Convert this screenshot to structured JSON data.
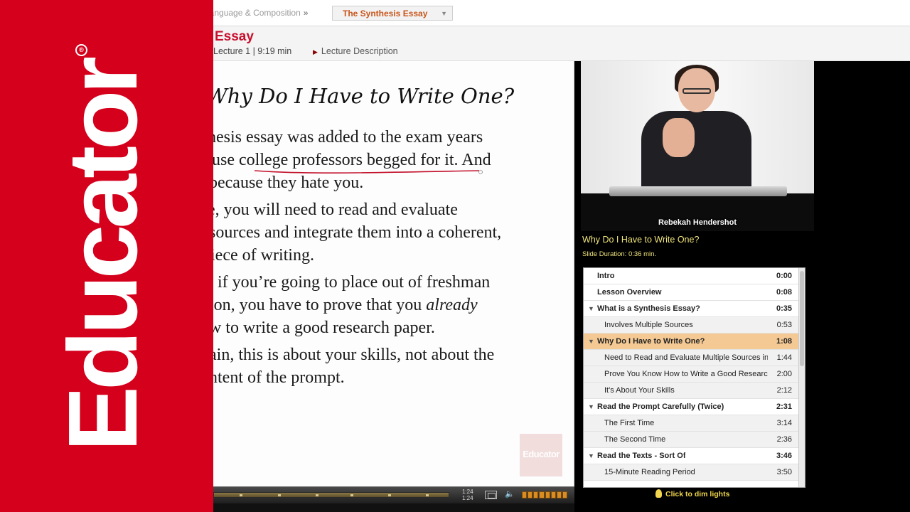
{
  "breadcrumb": {
    "course": "h Language & Composition",
    "separator": "»",
    "lesson_select": "The Synthesis Essay"
  },
  "lesson": {
    "title": "Essay",
    "meta": "Lecture 1 | 9:19 min",
    "description_link": "Lecture Description"
  },
  "brand": {
    "logo_text": "Educator",
    "reg_mark": "®",
    "color": "#d4001c"
  },
  "slide": {
    "heading": "Why Do I Have to Write One?",
    "lines": [
      "hesis essay was added to the exam years",
      "use college professors begged for it. And",
      "because they hate you.",
      "e, you will need to read and evaluate",
      "sources and integrate them into a coherent,",
      "iece of writing.",
      ", if you’re going to place out of freshman",
      "ion, you have to prove that you ",
      "already",
      "w to write a good research paper.",
      "ain, this is about your skills, not about the",
      "ntent of the prompt."
    ],
    "watermark": "Educator"
  },
  "player": {
    "time_current": "1:24",
    "time_total": "1:24",
    "fullscreen_icon": "fullscreen-icon",
    "volume_icon": "speaker-icon"
  },
  "video": {
    "presenter": "Rebekah Hendershot",
    "slide_title": "Why Do I Have to Write One?",
    "slide_duration": "Slide Duration: 0:36 min."
  },
  "chapters": [
    {
      "label": "Intro",
      "time": "0:00",
      "level": "main",
      "arrow": ""
    },
    {
      "label": "Lesson Overview",
      "time": "0:08",
      "level": "main",
      "arrow": ""
    },
    {
      "label": "What is a Synthesis Essay?",
      "time": "0:35",
      "level": "main",
      "arrow": "▼"
    },
    {
      "label": "Involves Multiple Sources",
      "time": "0:53",
      "level": "sub",
      "arrow": ""
    },
    {
      "label": "Why Do I Have to Write One?",
      "time": "1:08",
      "level": "main",
      "arrow": "▼",
      "active": true
    },
    {
      "label": "Need to Read and Evaluate Multiple Sources in",
      "time": "1:44",
      "level": "sub",
      "arrow": ""
    },
    {
      "label": "Prove You Know How to Write a Good Research",
      "time": "2:00",
      "level": "sub",
      "arrow": ""
    },
    {
      "label": "It's About Your Skills",
      "time": "2:12",
      "level": "sub",
      "arrow": ""
    },
    {
      "label": "Read the Prompt Carefully (Twice)",
      "time": "2:31",
      "level": "main",
      "arrow": "▼"
    },
    {
      "label": "The First Time",
      "time": "3:14",
      "level": "sub",
      "arrow": ""
    },
    {
      "label": "The Second Time",
      "time": "2:36",
      "level": "sub",
      "arrow": ""
    },
    {
      "label": "Read the Texts - Sort Of",
      "time": "3:46",
      "level": "main",
      "arrow": "▼"
    },
    {
      "label": "15-Minute Reading Period",
      "time": "3:50",
      "level": "sub",
      "arrow": ""
    }
  ],
  "dim_lights": "Click to dim lights",
  "colors": {
    "brand_red": "#d4001c",
    "title_red": "#c8102e",
    "active_chapter": "#f4c994",
    "caption_yellow": "#f0e47a"
  }
}
